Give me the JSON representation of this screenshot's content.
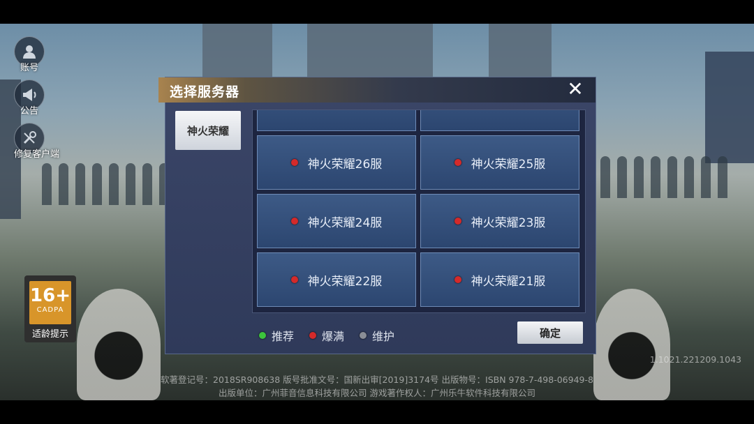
{
  "side_menu": {
    "account_label": "账号",
    "notice_label": "公告",
    "repair_label": "修复客户端"
  },
  "age_rating": {
    "rating": "16+",
    "org": "CADPA",
    "tip": "适龄提示"
  },
  "dialog": {
    "title": "选择服务器",
    "tab_label": "神火荣耀",
    "servers": [
      {
        "name": "神火荣耀26服",
        "status": "爆满"
      },
      {
        "name": "神火荣耀25服",
        "status": "爆满"
      },
      {
        "name": "神火荣耀24服",
        "status": "爆满"
      },
      {
        "name": "神火荣耀23服",
        "status": "爆满"
      },
      {
        "name": "神火荣耀22服",
        "status": "爆满"
      },
      {
        "name": "神火荣耀21服",
        "status": "爆满"
      }
    ],
    "legend": {
      "recommend": "推荐",
      "full": "爆满",
      "maintenance": "维护"
    },
    "confirm_label": "确定"
  },
  "footer": {
    "line1": "软著登记号：2018SR908638  版号批准文号：国新出审[2019]3174号 出版物号：ISBN 978-7-498-06949-8",
    "line2": "出版单位：广州菲音信息科技有限公司 游戏著作权人：广州乐牛软件科技有限公司",
    "version": "1.1021.221209.1043"
  },
  "colors": {
    "status_full": "#d42a2a",
    "status_recommend": "#3cc43c",
    "status_maintenance": "#8a8e96",
    "age_badge": "#d8952a"
  }
}
